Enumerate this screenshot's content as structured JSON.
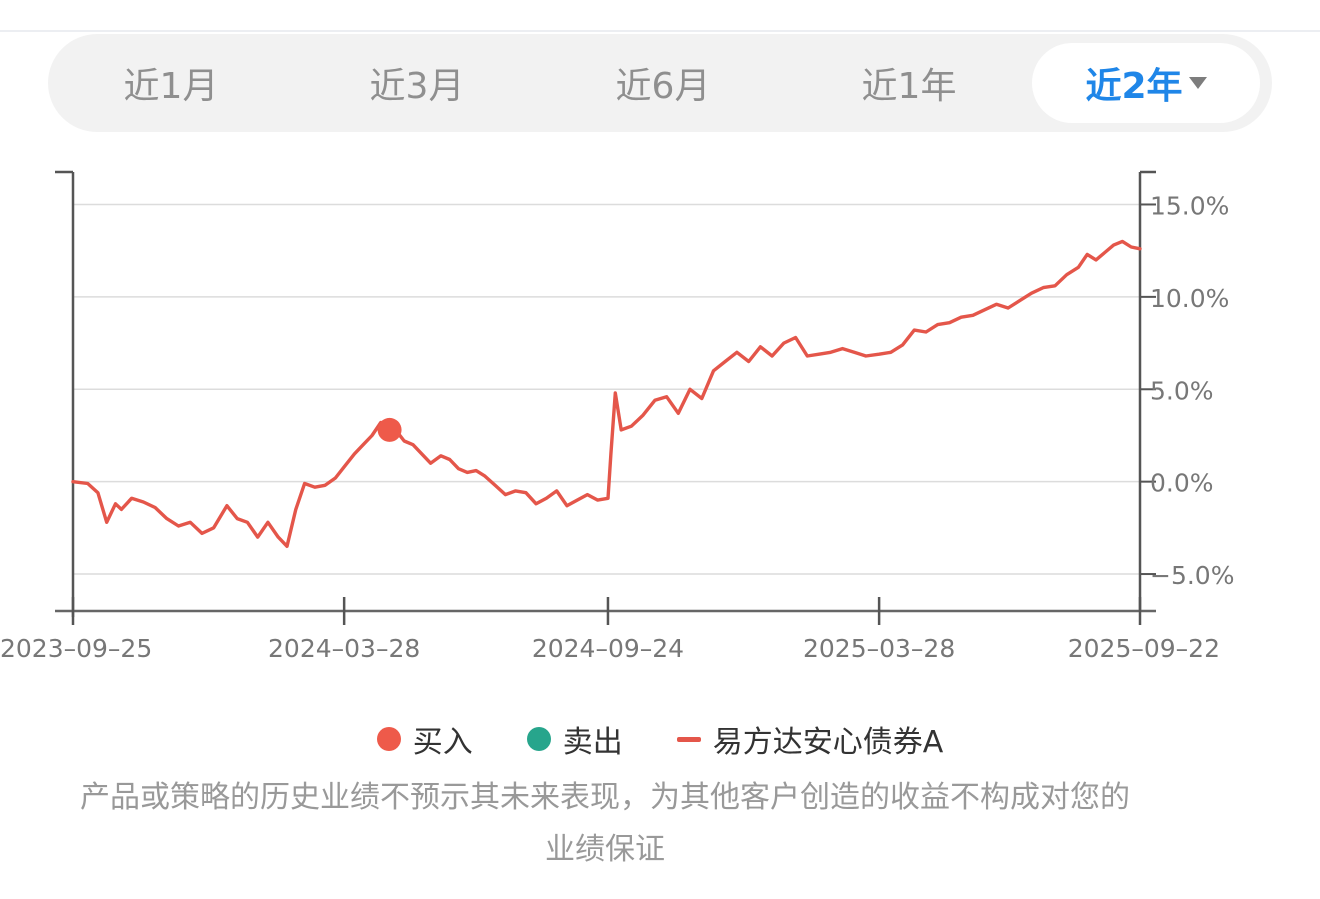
{
  "range_tabs": [
    {
      "label": "近1月",
      "active": false
    },
    {
      "label": "近3月",
      "active": false
    },
    {
      "label": "近6月",
      "active": false
    },
    {
      "label": "近1年",
      "active": false
    },
    {
      "label": "近2年",
      "active": true
    }
  ],
  "legend": {
    "buy": {
      "label": "买入",
      "color": "#ee5a4a"
    },
    "sell": {
      "label": "卖出",
      "color": "#27a58c"
    },
    "fund": {
      "label": "易方达安心债券A",
      "color": "#e4564a"
    }
  },
  "disclaimer": "产品或策略的历史业绩不预示其未来表现，为其他客户创造的收益不构成对您的业绩保证",
  "chart_data": {
    "type": "line",
    "x_range": [
      "2023-09-25",
      "2025-09-22"
    ],
    "x_ticks": [
      "2023-09-25",
      "2024-03-28",
      "2024-09-24",
      "2025-03-28",
      "2025-09-22"
    ],
    "y_axis_side": "right",
    "ylim": [
      -7.0,
      16.0
    ],
    "y_ticks": [
      15.0,
      10.0,
      5.0,
      0.0,
      -5.0
    ],
    "y_tick_labels": [
      "15.0%",
      "10.0%",
      "5.0%",
      "0.0%",
      "−5.0%"
    ],
    "grid": true,
    "series": [
      {
        "name": "易方达安心债券A",
        "x": [
          "2023-09-25",
          "2023-10-05",
          "2023-10-12",
          "2023-10-18",
          "2023-10-24",
          "2023-10-28",
          "2023-11-04",
          "2023-11-12",
          "2023-11-20",
          "2023-11-28",
          "2023-12-06",
          "2023-12-14",
          "2023-12-22",
          "2023-12-30",
          "2024-01-08",
          "2024-01-15",
          "2024-01-22",
          "2024-01-29",
          "2024-02-05",
          "2024-02-12",
          "2024-02-18",
          "2024-02-24",
          "2024-03-01",
          "2024-03-08",
          "2024-03-15",
          "2024-03-22",
          "2024-03-28",
          "2024-04-04",
          "2024-04-10",
          "2024-04-16",
          "2024-04-22",
          "2024-04-28",
          "2024-05-04",
          "2024-05-08",
          "2024-05-14",
          "2024-05-20",
          "2024-05-26",
          "2024-06-02",
          "2024-06-08",
          "2024-06-14",
          "2024-06-20",
          "2024-06-26",
          "2024-07-02",
          "2024-07-09",
          "2024-07-16",
          "2024-07-23",
          "2024-07-30",
          "2024-08-06",
          "2024-08-13",
          "2024-08-20",
          "2024-08-27",
          "2024-09-03",
          "2024-09-10",
          "2024-09-17",
          "2024-09-24",
          "2024-09-26",
          "2024-09-29",
          "2024-10-03",
          "2024-10-10",
          "2024-10-18",
          "2024-10-26",
          "2024-11-03",
          "2024-11-11",
          "2024-11-19",
          "2024-11-27",
          "2024-12-05",
          "2024-12-13",
          "2024-12-21",
          "2024-12-29",
          "2025-01-06",
          "2025-01-14",
          "2025-01-22",
          "2025-01-30",
          "2025-02-07",
          "2025-02-15",
          "2025-02-23",
          "2025-03-03",
          "2025-03-11",
          "2025-03-19",
          "2025-03-28",
          "2025-04-05",
          "2025-04-13",
          "2025-04-21",
          "2025-04-29",
          "2025-05-07",
          "2025-05-15",
          "2025-05-23",
          "2025-05-31",
          "2025-06-08",
          "2025-06-16",
          "2025-06-24",
          "2025-07-02",
          "2025-07-10",
          "2025-07-18",
          "2025-07-26",
          "2025-08-03",
          "2025-08-11",
          "2025-08-17",
          "2025-08-23",
          "2025-08-29",
          "2025-09-04",
          "2025-09-10",
          "2025-09-16",
          "2025-09-22"
        ],
        "y": [
          0.0,
          -0.1,
          -0.6,
          -2.2,
          -1.2,
          -1.5,
          -0.9,
          -1.1,
          -1.4,
          -2.0,
          -2.4,
          -2.2,
          -2.8,
          -2.5,
          -1.3,
          -2.0,
          -2.2,
          -3.0,
          -2.2,
          -3.0,
          -3.5,
          -1.5,
          -0.1,
          -0.3,
          -0.2,
          0.2,
          0.8,
          1.5,
          2.0,
          2.5,
          3.2,
          3.0,
          2.6,
          2.2,
          2.0,
          1.5,
          1.0,
          1.4,
          1.2,
          0.7,
          0.5,
          0.6,
          0.3,
          -0.2,
          -0.7,
          -0.5,
          -0.6,
          -1.2,
          -0.9,
          -0.5,
          -1.3,
          -1.0,
          -0.7,
          -1.0,
          -0.9,
          1.5,
          4.8,
          2.8,
          3.0,
          3.6,
          4.4,
          4.6,
          3.7,
          5.0,
          4.5,
          6.0,
          6.5,
          7.0,
          6.5,
          7.3,
          6.8,
          7.5,
          7.8,
          6.8,
          6.9,
          7.0,
          7.2,
          7.0,
          6.8,
          6.9,
          7.0,
          7.4,
          8.2,
          8.1,
          8.5,
          8.6,
          8.9,
          9.0,
          9.3,
          9.6,
          9.4,
          9.8,
          10.2,
          10.5,
          10.6,
          11.2,
          11.6,
          12.3,
          12.0,
          12.4,
          12.8,
          13.0,
          12.7,
          12.6
        ]
      }
    ],
    "buy_points": [
      {
        "x": "2024-04-28",
        "y": 2.8
      }
    ],
    "sell_points": []
  }
}
